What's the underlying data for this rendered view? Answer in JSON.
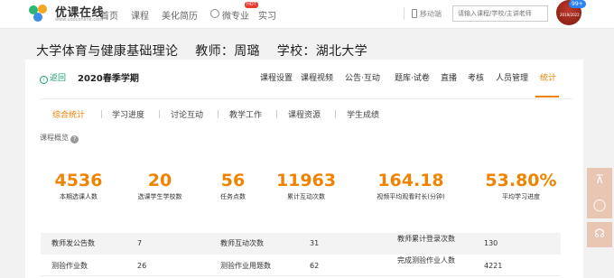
{
  "header": {
    "logo_text": "优课在线",
    "logo_sub": "www.uooconline.com",
    "nav": [
      {
        "label": "首页"
      },
      {
        "label": "课程"
      },
      {
        "label": "美化简历"
      },
      {
        "label": "微专业"
      },
      {
        "label": "实习"
      }
    ],
    "hot_badge": "HOT",
    "mobile_label": "移动端",
    "search_placeholder": "请输入课程/学校/主讲老师",
    "avatar_text": "2019/2022",
    "message_count": "99+"
  },
  "course": {
    "title": "大学体育与健康基础理论    教师：周璐    学校：湖北大学"
  },
  "card": {
    "back_label": "返回",
    "semester": "2020春季学期",
    "tabs": [
      {
        "label": "课程设置"
      },
      {
        "label": "课程视频"
      },
      {
        "label": "公告·互动"
      },
      {
        "label": "题库·试卷"
      },
      {
        "label": "直播"
      },
      {
        "label": "考核"
      },
      {
        "label": "人员管理"
      },
      {
        "label": "统计"
      }
    ],
    "active_tab": "统计",
    "subtabs": [
      {
        "label": "综合统计"
      },
      {
        "label": "学习进度"
      },
      {
        "label": "讨论互动"
      },
      {
        "label": "教学工作"
      },
      {
        "label": "课程资源"
      },
      {
        "label": "学生成绩"
      }
    ],
    "overview_label": "课程概览",
    "stats": [
      {
        "value": "4536",
        "label": "本期选课人数"
      },
      {
        "value": "20",
        "label": "选课学生学校数"
      },
      {
        "value": "56",
        "label": "任务点数"
      },
      {
        "value": "11963",
        "label": "累计互动次数"
      },
      {
        "value": "164.18",
        "label": "视频平均观看时长(分钟)"
      },
      {
        "value": "53.80%",
        "label": "平均学习进度"
      }
    ],
    "table": [
      [
        {
          "label": "教师发公告数",
          "value": "7"
        },
        {
          "label": "教师互动次数",
          "value": "31"
        },
        {
          "label": "教师累计登录次数",
          "value": "130"
        }
      ],
      [
        {
          "label": "测验作业数",
          "value": "26"
        },
        {
          "label": "测验作业用题数",
          "value": "62"
        },
        {
          "label": "完成测验作业人数",
          "value": "4221"
        }
      ]
    ]
  },
  "accent_color": "#f08300",
  "floating": [
    {
      "icon": "back-to-top-icon"
    },
    {
      "icon": "feedback-icon"
    },
    {
      "icon": "customer-service-icon"
    }
  ]
}
